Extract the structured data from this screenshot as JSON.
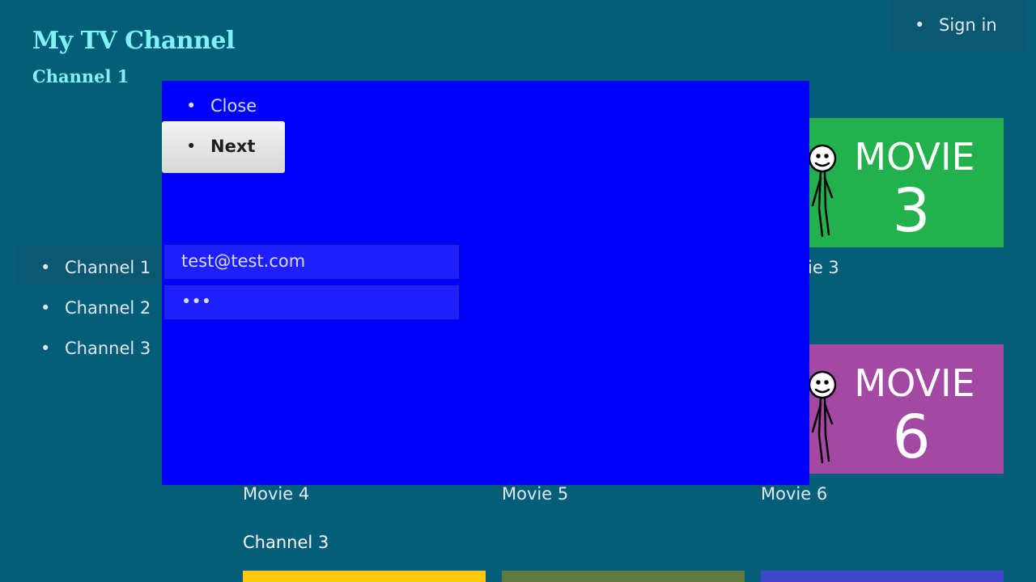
{
  "header": {
    "app_title": "My TV Channel",
    "channel_subtitle": "Channel 1",
    "sign_in_label": "Sign in"
  },
  "channel_menu": {
    "items": [
      {
        "label": "Channel 1",
        "active": true
      },
      {
        "label": "Channel 2",
        "active": false
      },
      {
        "label": "Channel 3",
        "active": false
      }
    ]
  },
  "movies": {
    "visible_tiles": [
      {
        "title": "MOVIE",
        "number": "3",
        "color": "#22b14c"
      },
      {
        "title": "MOVIE",
        "number": "6",
        "color": "#a349a4"
      }
    ],
    "labels": {
      "movie3_partial": "ie 3",
      "movie4": "Movie 4",
      "movie5": "Movie 5",
      "movie6": "Movie 6"
    },
    "next_row_title": "Channel 3",
    "next_row_colors": [
      "#ffc90e",
      "#5f7a3a",
      "#3f48cc"
    ]
  },
  "sign_in_dialog": {
    "close_label": "Close",
    "next_label": "Next",
    "email_value": "test@test.com",
    "password_value": "•••",
    "background": "#0000ff"
  }
}
